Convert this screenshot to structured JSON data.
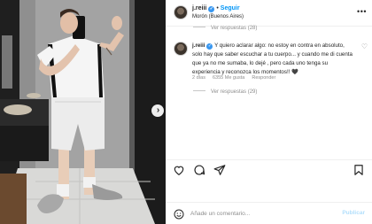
{
  "post": {
    "username": "j.reiii",
    "follow_label": "Seguir",
    "location": "Morón (Buenos Aires)"
  },
  "replies": {
    "first_label": "Ver respuestas (28)",
    "second_label": "Ver respuestas (29)"
  },
  "comment": {
    "username": "j.reiii",
    "text": "Y quiero aclarar algo: no estoy en contra en absoluto, solo hay que saber escuchar a tu cuerpo... y cuando me di cuenta que ya no me sumaba, lo dejé , pero cada uno tenga su experiencia y reconozca los momentos!! 🖤",
    "age": "2 días",
    "likes": "6355 Me gusta",
    "reply_label": "Responder"
  },
  "add_comment": {
    "placeholder": "Añade un comentario...",
    "publish_label": "Publicar"
  },
  "icons": {
    "photo_next": "chevron-right-icon",
    "header_more": "more-horizontal-icon",
    "comment_like": "heart-outline-icon",
    "like": "heart-icon",
    "comment": "comment-bubble-icon",
    "share": "paper-plane-icon",
    "save": "bookmark-icon",
    "emoji": "emoji-icon"
  },
  "colors": {
    "accent": "#0095f6",
    "verified": "#3897f0",
    "muted": "#8e8e8e",
    "publish_disabled": "#b2dffc"
  }
}
